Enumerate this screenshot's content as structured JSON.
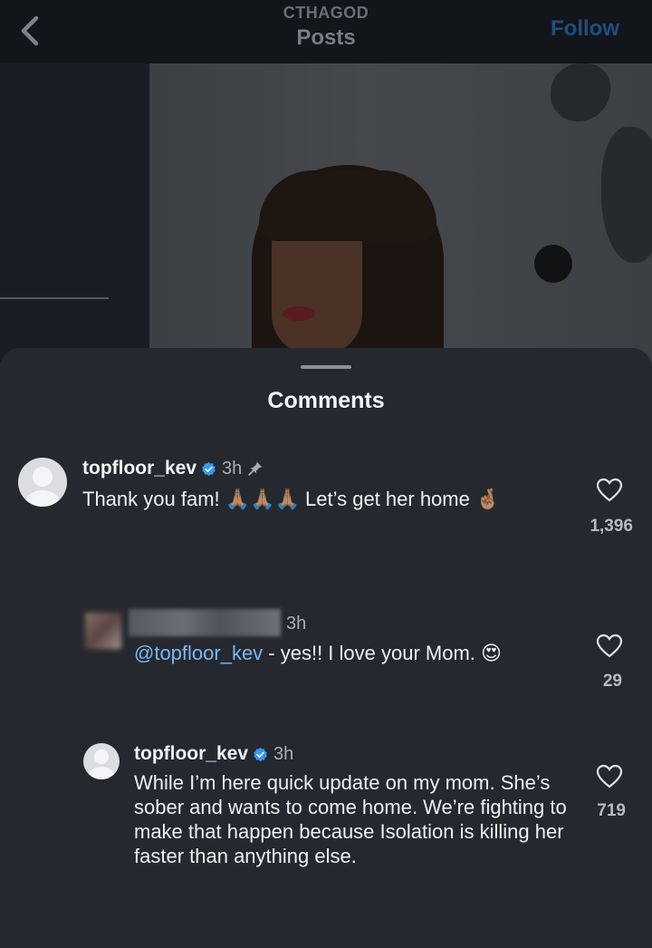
{
  "header": {
    "account_name": "CTHAGOD",
    "title": "Posts",
    "follow_label": "Follow",
    "back_icon": "chevron-left-icon"
  },
  "sheet": {
    "title": "Comments"
  },
  "comments": [
    {
      "username": "topfloor_kev",
      "verified": true,
      "time": "3h",
      "pinned": true,
      "text": "Thank you fam! 🙏🏽🙏🏽🙏🏽 Let’s get her home 🤞🏽",
      "likes": "1,396"
    },
    {
      "username": "",
      "verified": false,
      "time": "3h",
      "pinned": false,
      "mention": "@topfloor_kev",
      "text": " - yes!! I love your Mom. 😍",
      "likes": "29"
    },
    {
      "username": "topfloor_kev",
      "verified": true,
      "time": "3h",
      "pinned": false,
      "text": "While I’m here quick update on my mom. She’s sober and wants to come home. We’re fighting to make that happen because Isolation is killing her faster than anything else.",
      "likes": "719"
    }
  ],
  "colors": {
    "background": "#25292f",
    "mention": "#79b8f2",
    "verified": "#3897f0",
    "follow_dimmed": "#1d4f80"
  }
}
